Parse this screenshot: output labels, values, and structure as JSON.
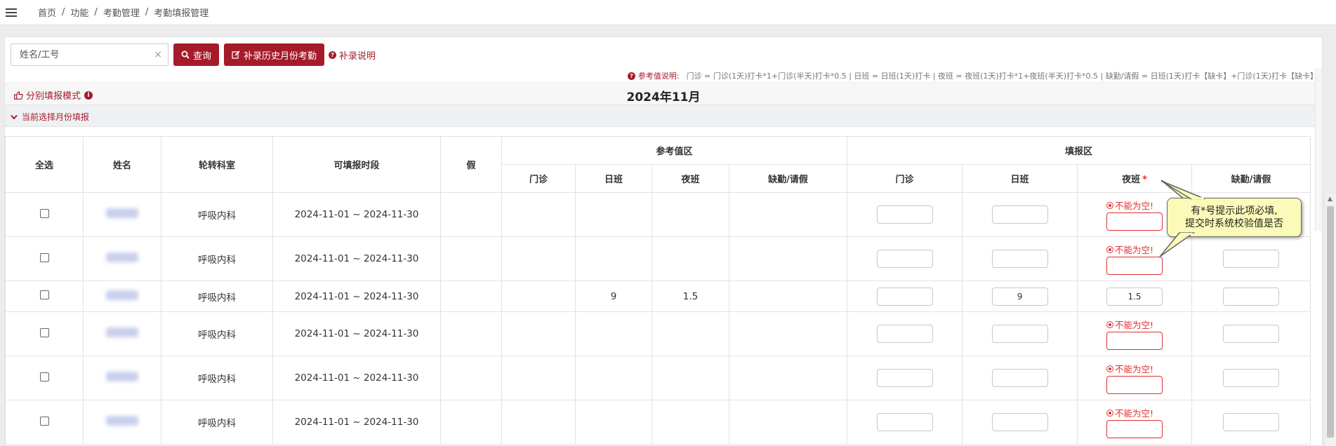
{
  "breadcrumb": [
    "首页",
    "功能",
    "考勤管理",
    "考勤填报管理"
  ],
  "search": {
    "placeholder": "姓名/工号",
    "value": ""
  },
  "buttons": {
    "query": "查询",
    "supplement": "补录历史月份考勤",
    "supplement_help": "补录说明"
  },
  "ref_note": {
    "label": "参考值说明:",
    "text": "门诊 = 门诊(1天)打卡*1+门诊(半天)打卡*0.5 | 日班 = 日班(1天)打卡 | 夜班 = 夜班(1天)打卡*1+夜班(半天)打卡*0.5 | 缺勤/请假 = 日班(1天)打卡【缺卡】+门诊(1天)打卡【缺卡】"
  },
  "mode": {
    "label": "分别填报模式"
  },
  "month_title": "2024年11月",
  "section": {
    "label": "当前选择月份填报"
  },
  "table": {
    "headers": {
      "select_all": "全选",
      "name": "姓名",
      "department": "轮转科室",
      "period": "可填报时段",
      "leave": "假",
      "ref_group": "参考值区",
      "fill_group": "填报区",
      "outpatient": "门诊",
      "day_shift": "日班",
      "night_shift": "夜班",
      "absence": "缺勤/请假",
      "required_star": "*"
    },
    "error_text": "不能为空!",
    "rows": [
      {
        "department": "呼吸内科",
        "period": "2024-11-01 ~ 2024-11-30",
        "ref_day": "",
        "ref_night": "",
        "fill_day": "",
        "fill_night": "",
        "night_invalid": true
      },
      {
        "department": "呼吸内科",
        "period": "2024-11-01 ~ 2024-11-30",
        "ref_day": "",
        "ref_night": "",
        "fill_day": "",
        "fill_night": "",
        "night_invalid": true
      },
      {
        "department": "呼吸内科",
        "period": "2024-11-01 ~ 2024-11-30",
        "ref_day": "9",
        "ref_night": "1.5",
        "fill_day": "9",
        "fill_night": "1.5",
        "night_invalid": false
      },
      {
        "department": "呼吸内科",
        "period": "2024-11-01 ~ 2024-11-30",
        "ref_day": "",
        "ref_night": "",
        "fill_day": "",
        "fill_night": "",
        "night_invalid": true
      },
      {
        "department": "呼吸内科",
        "period": "2024-11-01 ~ 2024-11-30",
        "ref_day": "",
        "ref_night": "",
        "fill_day": "",
        "fill_night": "",
        "night_invalid": true
      },
      {
        "department": "呼吸内科",
        "period": "2024-11-01 ~ 2024-11-30",
        "ref_day": "",
        "ref_night": "",
        "fill_day": "",
        "fill_night": "",
        "night_invalid": true
      }
    ]
  },
  "tooltip": {
    "line1": "有*号提示此项必填,",
    "line2": "提交时系统校验值是否"
  },
  "colors": {
    "brand": "#a61b2a",
    "error": "#e0302f",
    "tooltip_bg": "#fcfab8"
  }
}
